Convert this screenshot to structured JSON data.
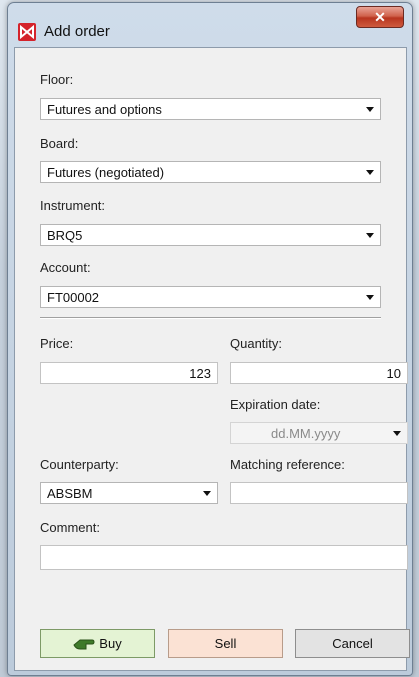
{
  "window": {
    "title": "Add order",
    "close_glyph": "✕"
  },
  "form": {
    "floor": {
      "label": "Floor:",
      "value": "Futures and options"
    },
    "board": {
      "label": "Board:",
      "value": "Futures (negotiated)"
    },
    "instrument": {
      "label": "Instrument:",
      "value": "BRQ5"
    },
    "account": {
      "label": "Account:",
      "value": "FT00002"
    },
    "price": {
      "label": "Price:",
      "value": "123"
    },
    "quantity": {
      "label": "Quantity:",
      "value": "10"
    },
    "expiration": {
      "label": "Expiration date:",
      "placeholder": "dd.MM.yyyy"
    },
    "counterparty": {
      "label": "Counterparty:",
      "value": "ABSBM"
    },
    "matching": {
      "label": "Matching reference:",
      "value": ""
    },
    "comment": {
      "label": "Comment:",
      "value": ""
    }
  },
  "buttons": {
    "buy": "Buy",
    "sell": "Sell",
    "cancel": "Cancel"
  },
  "icons": {
    "app": "moex-logo-icon",
    "buy": "hand-pointing-icon",
    "dropdown": "chevron-down-icon"
  },
  "colors": {
    "buy_bg": "#e4f3d4",
    "sell_bg": "#fbe2d4",
    "close_red": "#c8412a",
    "app_icon_red": "#d4232b"
  }
}
